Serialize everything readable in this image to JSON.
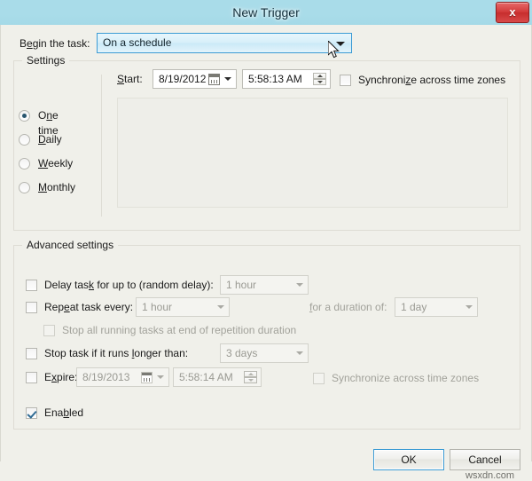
{
  "window": {
    "title": "New Trigger",
    "close_label": "x",
    "close_icon": "close-icon"
  },
  "begin": {
    "label": "Begin the task:",
    "value": "On a schedule",
    "options": [
      "On a schedule"
    ]
  },
  "settings": {
    "group_title": "Settings",
    "schedule_options": [
      {
        "label": "One time",
        "selected": true
      },
      {
        "label": "Daily",
        "selected": false
      },
      {
        "label": "Weekly",
        "selected": false
      },
      {
        "label": "Monthly",
        "selected": false
      }
    ],
    "start_label": "Start:",
    "start_date": "8/19/2012",
    "start_time": "5:58:13 AM",
    "sync_label": "Synchronize across time zones",
    "sync_checked": false
  },
  "advanced": {
    "group_title": "Advanced settings",
    "delay": {
      "label": "Delay task for up to (random delay):",
      "checked": false,
      "value": "1 hour"
    },
    "repeat": {
      "label": "Repeat task every:",
      "checked": false,
      "value": "1 hour",
      "duration_label": "for a duration of:",
      "duration_value": "1 day"
    },
    "stop_all": {
      "label": "Stop all running tasks at end of repetition duration",
      "checked": false
    },
    "stop_long": {
      "label": "Stop task if it runs longer than:",
      "checked": false,
      "value": "3 days"
    },
    "expire": {
      "label": "Expire:",
      "checked": false,
      "date": "8/19/2013",
      "time": "5:58:14 AM",
      "sync_label": "Synchronize across time zones",
      "sync_checked": false
    },
    "enabled": {
      "label": "Enabled",
      "checked": true
    }
  },
  "footer": {
    "ok_label": "OK",
    "cancel_label": "Cancel"
  },
  "watermark": "wsxdn.com",
  "colors": {
    "titlebar": "#a9dce9",
    "dialog_background": "#f0f0ea",
    "accent_focus": "#3c9bd4",
    "close_button": "#c62d2d",
    "radio_dot": "#28556e",
    "check_mark": "#2f6b93",
    "disabled_text": "#9a9a93"
  }
}
